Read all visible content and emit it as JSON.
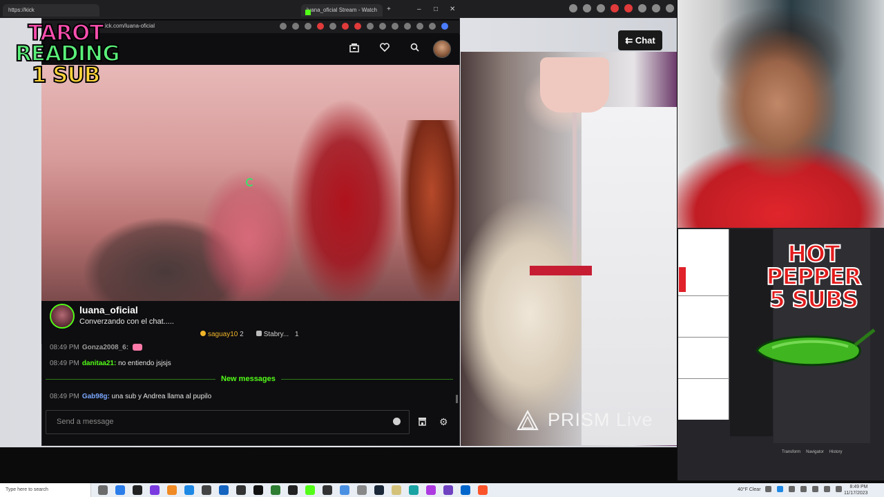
{
  "browser": {
    "tab_url_label": "https://kick",
    "active_tab_title": "luana_oficial Stream - Watch Li",
    "new_tab_symbol": "+",
    "window_controls": {
      "minimize": "–",
      "maximize": "□",
      "close": "✕"
    },
    "address": "kick.com/luana-oficial"
  },
  "header_icons": [
    "library-icon",
    "heart-icon",
    "search-icon",
    "avatar"
  ],
  "overlays": {
    "tarot": [
      "TAROT",
      "READING",
      "1 SUB"
    ],
    "hot_pepper": [
      "HOT",
      "PEPPER",
      "5 SUBS"
    ]
  },
  "channel": {
    "name": "luana_oficial",
    "title": "Converzando con el chat.....",
    "pinned": [
      {
        "name": "saguay10",
        "count": "2"
      },
      {
        "name": "Stabry...",
        "count": "1"
      }
    ]
  },
  "chat": {
    "messages": [
      {
        "time": "08:49 PM",
        "user": "Gonza2008_6:",
        "text": ""
      },
      {
        "time": "08:49 PM",
        "user": "danitaa21:",
        "text": "no entiendo jsjsjs"
      },
      {
        "time": "08:49 PM",
        "user": "Gab98g:",
        "text": "una sub y Andrea llama al pupilo"
      }
    ],
    "new_messages_label": "New messages",
    "input_placeholder": "Send a message"
  },
  "chat_button": "Chat",
  "prism": {
    "bold": "PRISM",
    "light": "Live"
  },
  "obs_tabs": [
    "Transform",
    "Navigator",
    "History"
  ],
  "taskbar": {
    "search_placeholder": "Type here to search",
    "weather": "40°F  Clear",
    "time": "8:49 PM",
    "date": "11/17/2023"
  },
  "colors": {
    "kick_green": "#53fc18",
    "accent_red": "#e31b1b"
  }
}
